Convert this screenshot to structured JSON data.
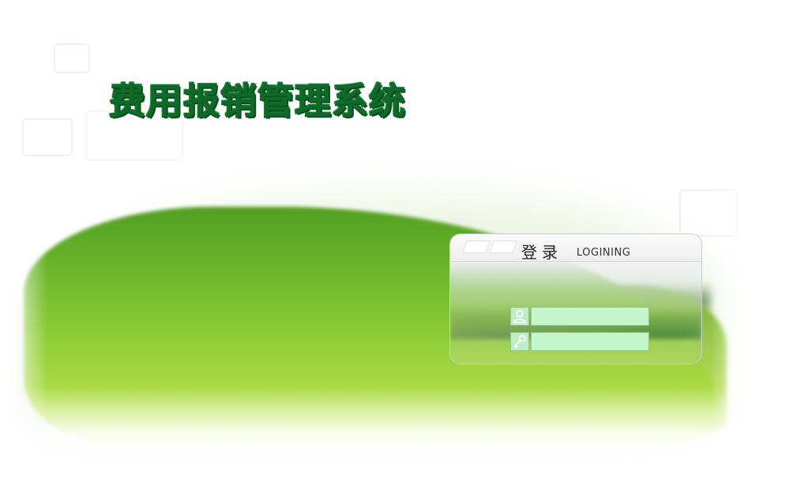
{
  "app": {
    "title": "费用报销管理系统"
  },
  "login": {
    "heading": "登录",
    "heading_sub": "LOGINING",
    "username": {
      "value": "",
      "icon": "user-icon"
    },
    "password": {
      "value": "",
      "icon": "key-icon"
    }
  },
  "colors": {
    "title_green": "#0f6a2a",
    "field_fill": "#c4f5cb",
    "field_border": "#8bc690",
    "grass": "#8ccc32"
  }
}
